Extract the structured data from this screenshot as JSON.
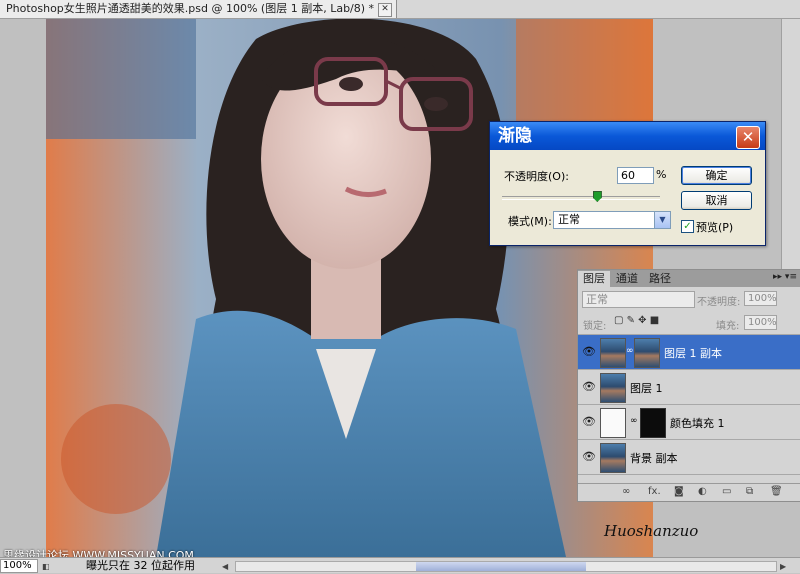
{
  "document": {
    "tab_title": "Photoshop女生照片通透甜美的效果.psd @ 100% (图层 1 副本, Lab/8) *",
    "close_glyph": "✕"
  },
  "dialog": {
    "title": "渐隐",
    "close_glyph": "✕",
    "opacity_label": "不透明度(O):",
    "opacity_value": "60",
    "opacity_unit": "%",
    "opacity_fraction": 0.6,
    "mode_label": "模式(M):",
    "mode_value": "正常",
    "ok_label": "确定",
    "cancel_label": "取消",
    "preview_label": "预览(P)",
    "preview_checked": true
  },
  "layers_panel": {
    "tabs": [
      "图层",
      "通道",
      "路径"
    ],
    "active_tab": 0,
    "blend_mode": "正常",
    "opacity_label": "不透明度:",
    "opacity_value": "100%",
    "lock_label": "锁定:",
    "fill_label": "填充:",
    "fill_value": "100%",
    "layers": [
      {
        "name": "图层 1 副本",
        "selected": true,
        "has_mask": true,
        "thumb": "photo"
      },
      {
        "name": "图层 1",
        "selected": false,
        "has_mask": false,
        "thumb": "photo"
      },
      {
        "name": "颜色填充 1",
        "selected": false,
        "has_mask": true,
        "thumb": "white"
      },
      {
        "name": "背景 副本",
        "selected": false,
        "has_mask": false,
        "thumb": "photo"
      }
    ],
    "footer_icons": [
      "link-icon",
      "fx-icon",
      "mask-icon",
      "adjustment-icon",
      "group-icon",
      "new-layer-icon",
      "trash-icon"
    ]
  },
  "status": {
    "zoom": "100%",
    "text": "曝光只在 32 位起作用"
  },
  "watermark": "思缘设计论坛 WWW.MISSYUAN.COM",
  "signature": "Huoshanzuo",
  "colors": {
    "dialog_title": "#0a58d8",
    "selected_layer": "#3a6ec7",
    "close_button": "#d9542f"
  }
}
